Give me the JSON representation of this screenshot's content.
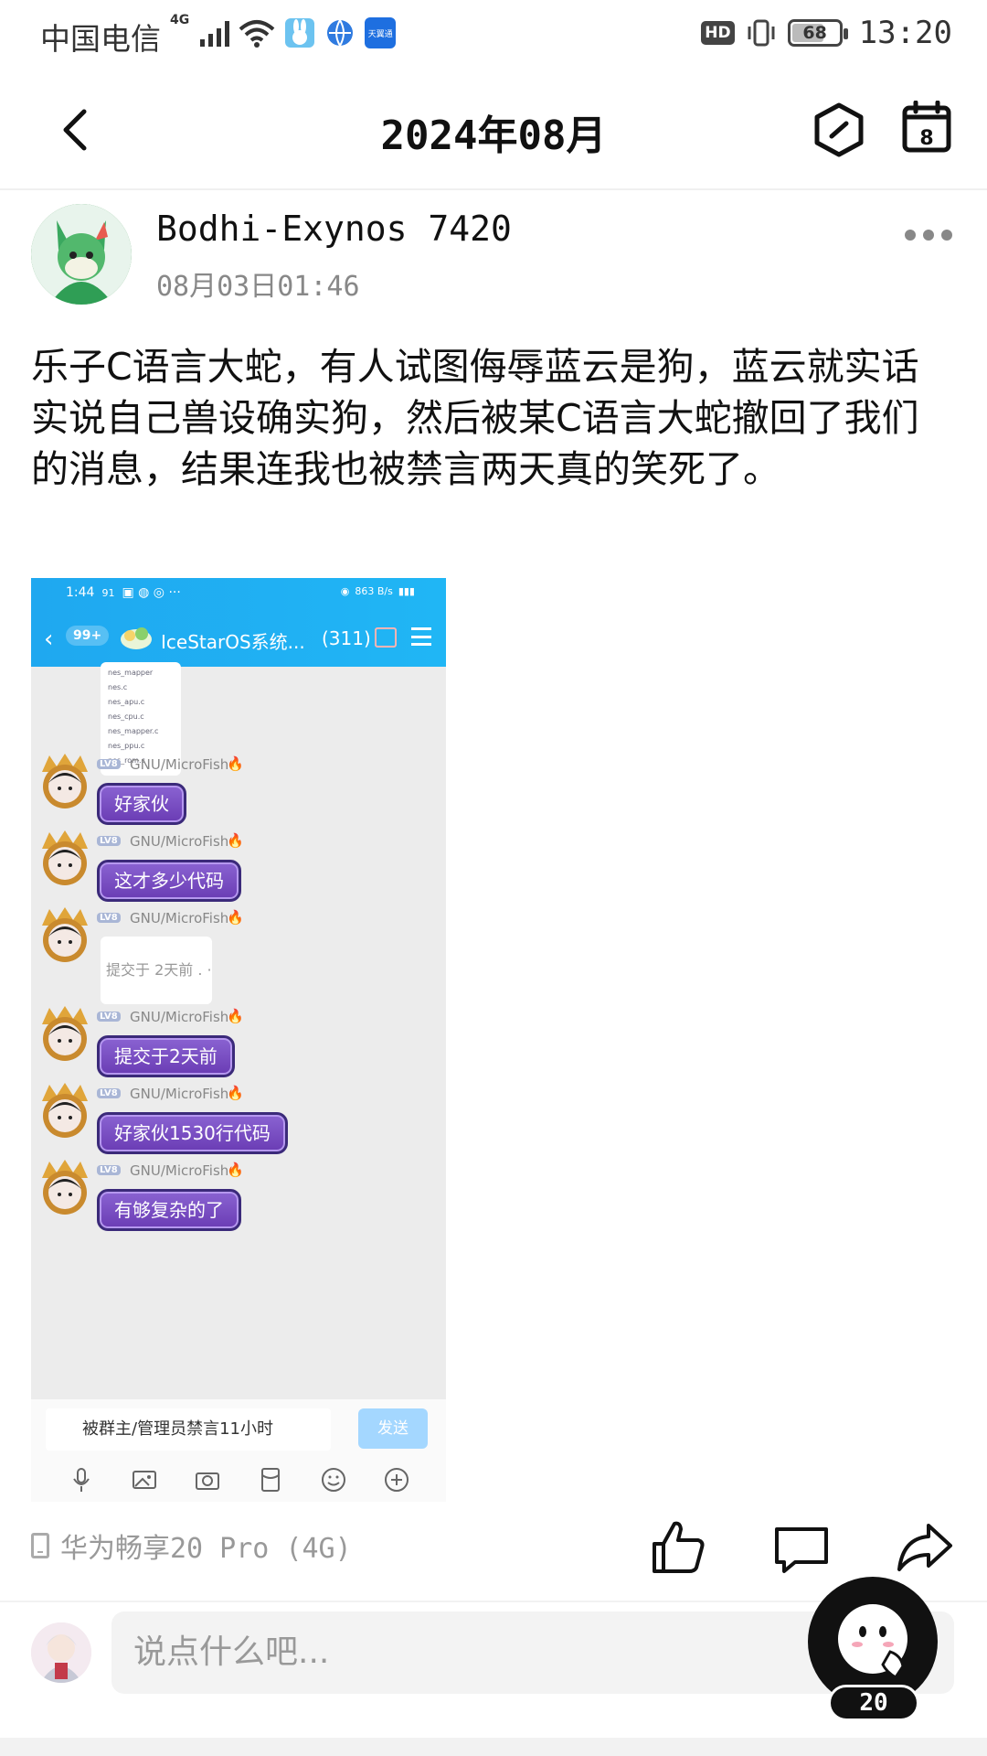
{
  "status_bar": {
    "carrier": "中国电信",
    "network": "4G",
    "hd": "HD",
    "battery": "68",
    "battery_level": 0.68,
    "time": "13:20",
    "app_badge": "天翼通"
  },
  "nav": {
    "title": "2024年08月",
    "calendar_day": "8"
  },
  "post": {
    "author": "Bodhi-Exynos 7420",
    "timestamp": "08月03日01:46",
    "text": "乐子C语言大蛇，有人试图侮辱蓝云是狗，蓝云就实话实说自己兽设确实狗，然后被某C语言大蛇撤回了我们的消息，结果连我也被禁言两天真的笑死了。",
    "device": "华为畅享20 Pro (4G)"
  },
  "screenshot": {
    "status_time": "1:44",
    "status_num": "91",
    "status_speed": "863 B/s",
    "unread_badge": "99+",
    "group_name": "IceStarOS系统...",
    "member_count": "(311)",
    "files": [
      "nes_mapper",
      "nes.c",
      "nes_apu.c",
      "nes_cpu.c",
      "nes_mapper.c",
      "nes_ppu.c",
      "nes_rom.c"
    ],
    "messages": [
      {
        "lv": "LV8",
        "name": "GNU/MicroFish",
        "text": "好家伙"
      },
      {
        "lv": "LV8",
        "name": "GNU/MicroFish",
        "text": "这才多少代码"
      },
      {
        "lv": "LV8",
        "name": "GNU/MicroFish",
        "text": "提交于 2天前 .  ·"
      },
      {
        "lv": "LV8",
        "name": "GNU/MicroFish",
        "text": "提交于2天前"
      },
      {
        "lv": "LV8",
        "name": "GNU/MicroFish",
        "text": "好家伙1530行代码"
      },
      {
        "lv": "LV8",
        "name": "GNU/MicroFish",
        "text": "有够复杂的了"
      }
    ],
    "input_text": "被群主/管理员禁言11小时",
    "send_label": "发送"
  },
  "comment": {
    "placeholder": "说点什么吧...",
    "fab_count": "20"
  },
  "colors": {
    "qq_header": "#1fa8f0",
    "bubble_purple": "#7a4fc4",
    "accent_text": "#111111"
  },
  "icons": [
    "back-icon",
    "hexagon-icon",
    "calendar-icon",
    "more-icon",
    "like-icon",
    "comment-icon",
    "share-icon",
    "phone-icon",
    "mascot-icon"
  ]
}
